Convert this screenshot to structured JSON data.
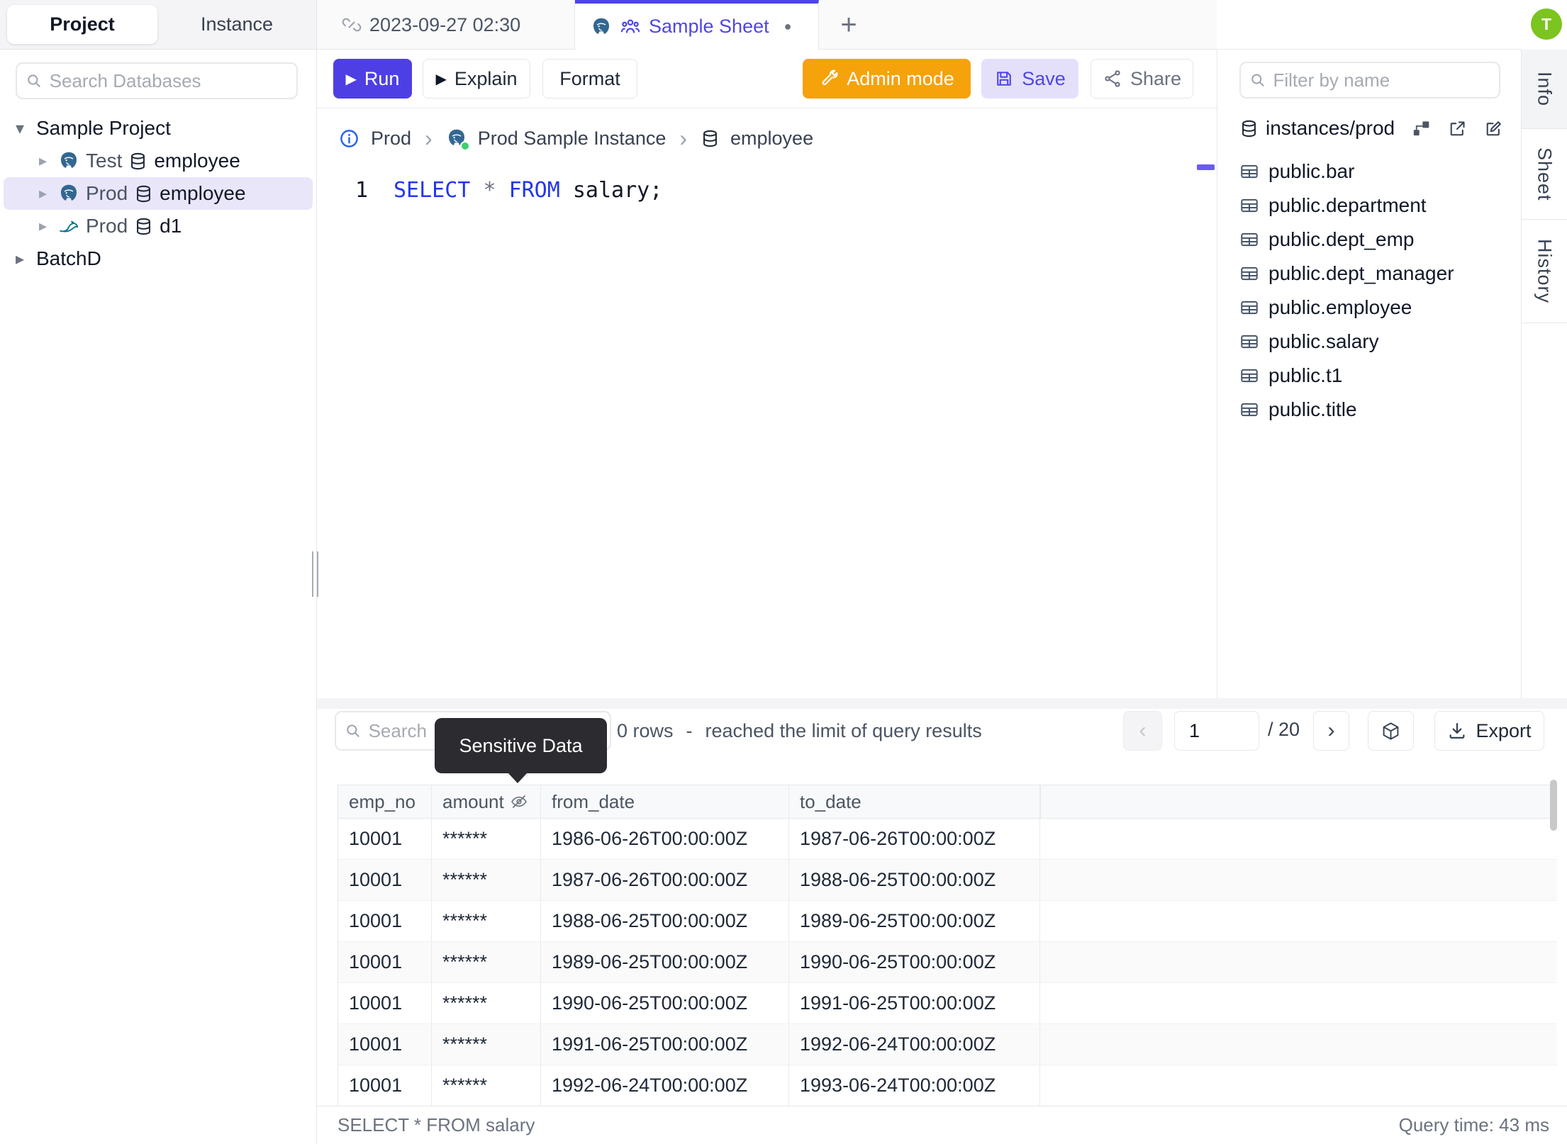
{
  "colors": {
    "accent": "#4F46E5",
    "warning": "#F5A20B",
    "avatar_green": "#7CC41F",
    "keyword_blue": "#2337EC",
    "tooltip_bg": "#2B2B30"
  },
  "icons": {
    "plus": "+",
    "chevron_left": "‹",
    "chevron_right": "›",
    "breadcrumb_sep": "›",
    "caret_down": "▾",
    "caret_right": "▸",
    "dirty_dot": "●",
    "play": "▶"
  },
  "avatar": {
    "initial": "T"
  },
  "left_panel": {
    "tabs": [
      {
        "label": "Project",
        "active": true
      },
      {
        "label": "Instance",
        "active": false
      }
    ],
    "search_placeholder": "Search Databases",
    "tree": {
      "project_label": "Sample Project",
      "databases": [
        {
          "env": "Test",
          "engine": "postgresql",
          "name": "employee",
          "selected": false
        },
        {
          "env": "Prod",
          "engine": "postgresql",
          "name": "employee",
          "selected": true
        },
        {
          "env": "Prod",
          "engine": "mysql",
          "name": "d1",
          "selected": false
        }
      ],
      "other_project": "BatchD"
    }
  },
  "tab_bar": {
    "tabs": [
      {
        "label": "2023-09-27 02:30",
        "active": false
      },
      {
        "label": "Sample Sheet",
        "active": true,
        "dirty": true
      }
    ]
  },
  "toolbar": {
    "run": "Run",
    "explain": "Explain",
    "format": "Format",
    "admin_mode": "Admin mode",
    "save": "Save",
    "share": "Share"
  },
  "breadcrumb": {
    "environment": "Prod",
    "instance": "Prod Sample Instance",
    "database": "employee"
  },
  "editor": {
    "line_number": "1",
    "tokens": {
      "select": "SELECT",
      "star": "*",
      "from": "FROM",
      "rest": " salary;"
    }
  },
  "schema_panel": {
    "filter_placeholder": "Filter by name",
    "connection": "instances/prod",
    "tables": [
      "public.bar",
      "public.department",
      "public.dept_emp",
      "public.dept_manager",
      "public.employee",
      "public.salary",
      "public.t1",
      "public.title"
    ]
  },
  "side_tabs": {
    "info": "Info",
    "sheet": "Sheet",
    "history": "History"
  },
  "results": {
    "search_placeholder": "Search",
    "tooltip": "Sensitive Data",
    "rows_count": "0 rows",
    "dash": "-",
    "limit_note": "reached the limit of query results",
    "pagination": {
      "page": "1",
      "total": "/ 20"
    },
    "export_label": "Export",
    "columns": [
      "emp_no",
      "amount",
      "from_date",
      "to_date"
    ],
    "rows": [
      [
        "10001",
        "******",
        "1986-06-26T00:00:00Z",
        "1987-06-26T00:00:00Z"
      ],
      [
        "10001",
        "******",
        "1987-06-26T00:00:00Z",
        "1988-06-25T00:00:00Z"
      ],
      [
        "10001",
        "******",
        "1988-06-25T00:00:00Z",
        "1989-06-25T00:00:00Z"
      ],
      [
        "10001",
        "******",
        "1989-06-25T00:00:00Z",
        "1990-06-25T00:00:00Z"
      ],
      [
        "10001",
        "******",
        "1990-06-25T00:00:00Z",
        "1991-06-25T00:00:00Z"
      ],
      [
        "10001",
        "******",
        "1991-06-25T00:00:00Z",
        "1992-06-24T00:00:00Z"
      ],
      [
        "10001",
        "******",
        "1992-06-24T00:00:00Z",
        "1993-06-24T00:00:00Z"
      ]
    ],
    "status_query": "SELECT * FROM salary",
    "status_time": "Query time: 43 ms"
  }
}
